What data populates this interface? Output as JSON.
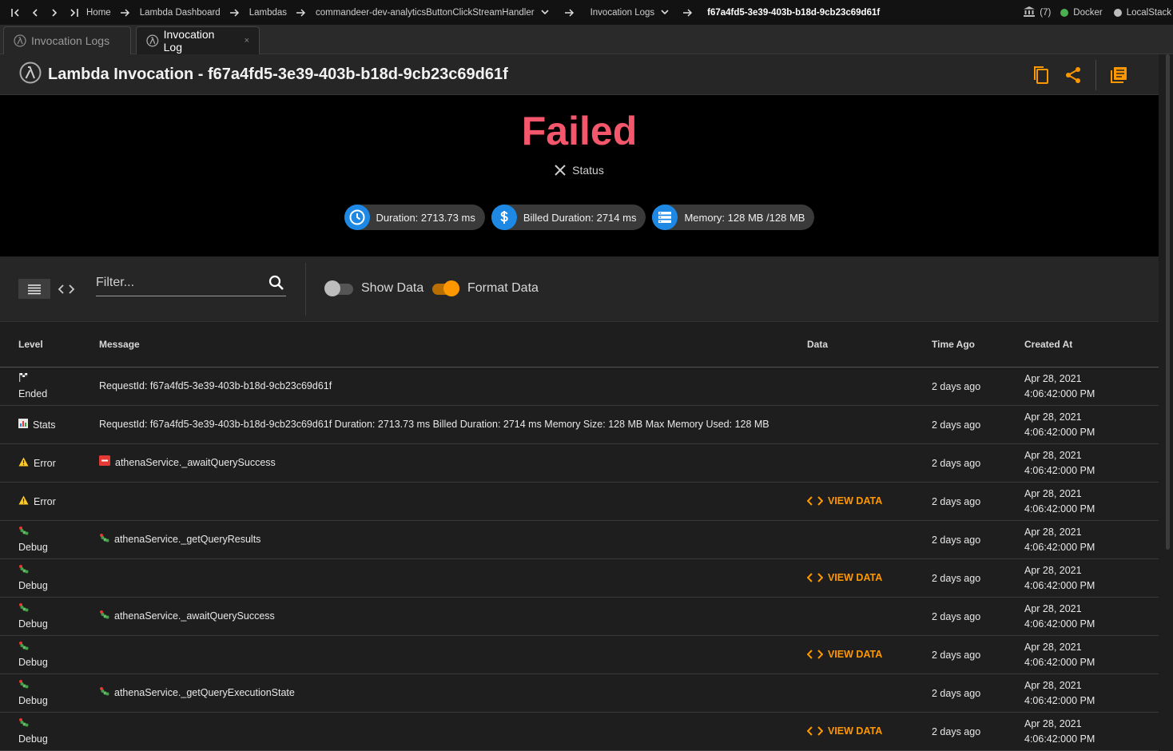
{
  "breadcrumb": {
    "items": [
      {
        "label": "Home"
      },
      {
        "label": "Lambda Dashboard"
      },
      {
        "label": "Lambdas"
      },
      {
        "label": "commandeer-dev-analyticsButtonClickStreamHandler"
      },
      {
        "label": "Invocation Logs"
      },
      {
        "label": "f67a4fd5-3e39-403b-b18d-9cb23c69d61f"
      }
    ]
  },
  "topbar": {
    "count": "(7)",
    "docker_label": "Docker",
    "localstack_label": "LocalStack",
    "docker_color": "#4caf50",
    "localstack_color": "#bdbdbd"
  },
  "tabs": [
    {
      "label": "Invocation Logs"
    },
    {
      "label": "Invocation Log",
      "close": "×"
    }
  ],
  "header": {
    "title": "Lambda Invocation - f67a4fd5-3e39-403b-b18d-9cb23c69d61f"
  },
  "status": {
    "value": "Failed",
    "label": "Status",
    "color": "#f4566b"
  },
  "chips": {
    "duration": "Duration: 2713.73 ms",
    "billed": "Billed Duration: 2714 ms",
    "memory": "Memory: 128 MB /128 MB"
  },
  "toolbar": {
    "filter_placeholder": "Filter...",
    "show_data_label": "Show Data",
    "format_data_label": "Format Data"
  },
  "table": {
    "headers": {
      "level": "Level",
      "message": "Message",
      "data": "Data",
      "time_ago": "Time Ago",
      "created_at": "Created At"
    },
    "view_data_label": "VIEW DATA",
    "rows": [
      {
        "level": "Ended",
        "message": "RequestId: f67a4fd5-3e39-403b-b18d-9cb23c69d61f",
        "time_ago": "2 days ago",
        "date": "Apr 28, 2021",
        "time": "4:06:42:000 PM"
      },
      {
        "level": "Stats",
        "message": "RequestId: f67a4fd5-3e39-403b-b18d-9cb23c69d61f Duration: 2713.73 ms Billed Duration: 2714 ms Memory Size: 128 MB Max Memory Used: 128 MB",
        "time_ago": "2 days ago",
        "date": "Apr 28, 2021",
        "time": "4:06:42:000 PM"
      },
      {
        "level": "Error",
        "message": "athenaService._awaitQuerySuccess",
        "time_ago": "2 days ago",
        "date": "Apr 28, 2021",
        "time": "4:06:42:000 PM"
      },
      {
        "level": "Error",
        "message": "",
        "time_ago": "2 days ago",
        "date": "Apr 28, 2021",
        "time": "4:06:42:000 PM"
      },
      {
        "level": "Debug",
        "message": "athenaService._getQueryResults",
        "time_ago": "2 days ago",
        "date": "Apr 28, 2021",
        "time": "4:06:42:000 PM"
      },
      {
        "level": "Debug",
        "message": "",
        "time_ago": "2 days ago",
        "date": "Apr 28, 2021",
        "time": "4:06:42:000 PM"
      },
      {
        "level": "Debug",
        "message": "athenaService._awaitQuerySuccess",
        "time_ago": "2 days ago",
        "date": "Apr 28, 2021",
        "time": "4:06:42:000 PM"
      },
      {
        "level": "Debug",
        "message": "",
        "time_ago": "2 days ago",
        "date": "Apr 28, 2021",
        "time": "4:06:42:000 PM"
      },
      {
        "level": "Debug",
        "message": "athenaService._getQueryExecutionState",
        "time_ago": "2 days ago",
        "date": "Apr 28, 2021",
        "time": "4:06:42:000 PM"
      },
      {
        "level": "Debug",
        "message": "",
        "time_ago": "2 days ago",
        "date": "Apr 28, 2021",
        "time": "4:06:42:000 PM"
      }
    ]
  },
  "colors": {
    "accent": "#ff9800",
    "chip_icon": "#1e88e5"
  }
}
